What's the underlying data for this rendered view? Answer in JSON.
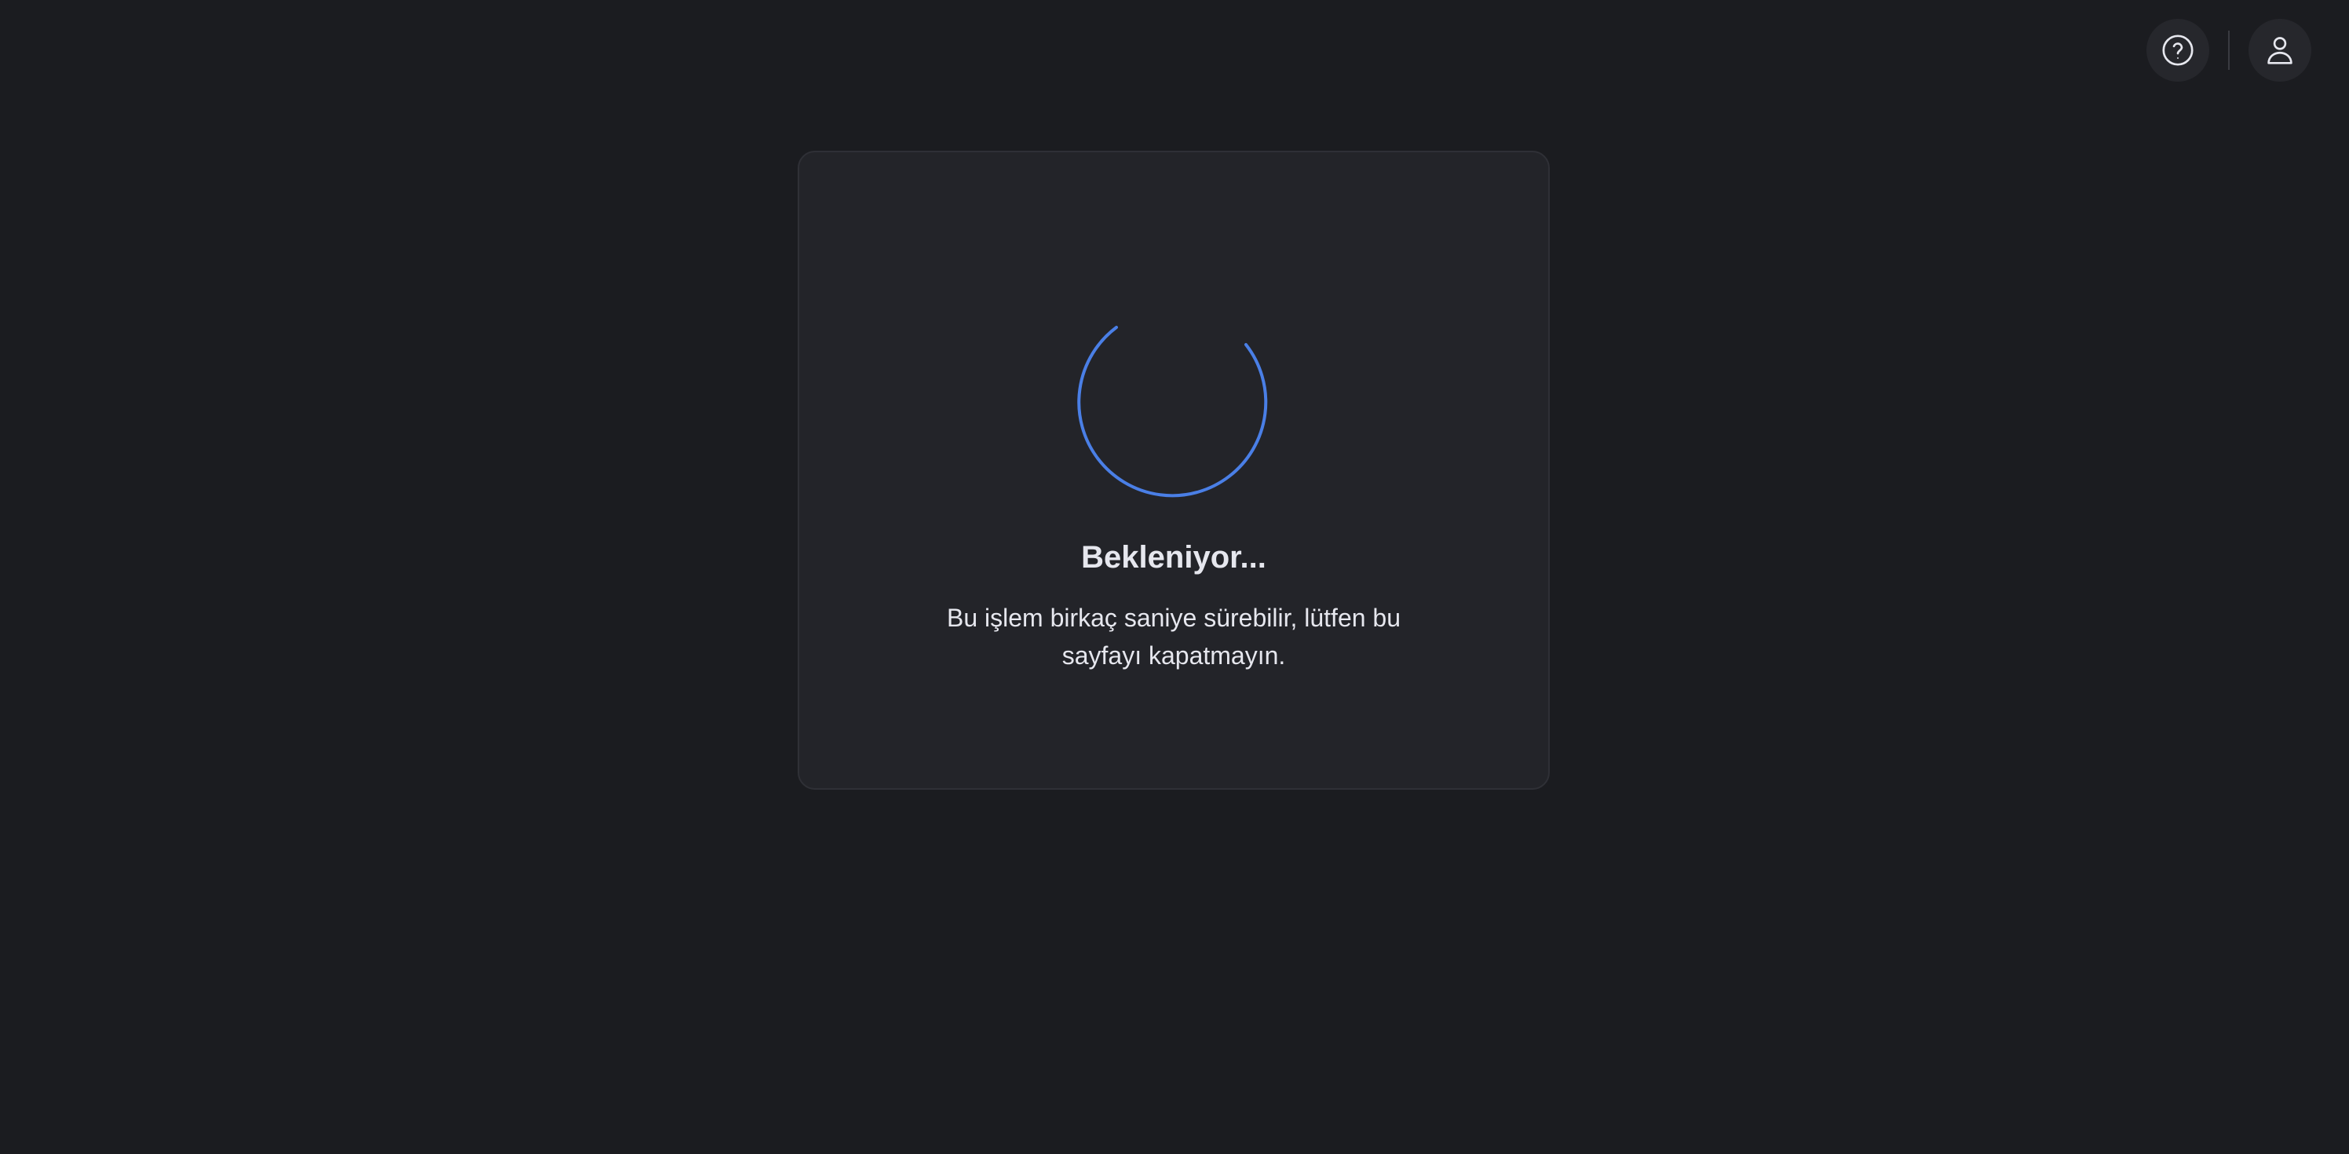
{
  "header": {
    "help_icon": "question-circle-icon",
    "user_icon": "user-icon"
  },
  "loading": {
    "title": "Bekleniyor...",
    "message": "Bu işlem birkaç saniye sürebilir, lütfen bu sayfayı kapatmayın."
  },
  "colors": {
    "background": "#1b1c20",
    "card": "#232429",
    "accent": "#4a7fe6",
    "text": "#e6e7ee"
  }
}
